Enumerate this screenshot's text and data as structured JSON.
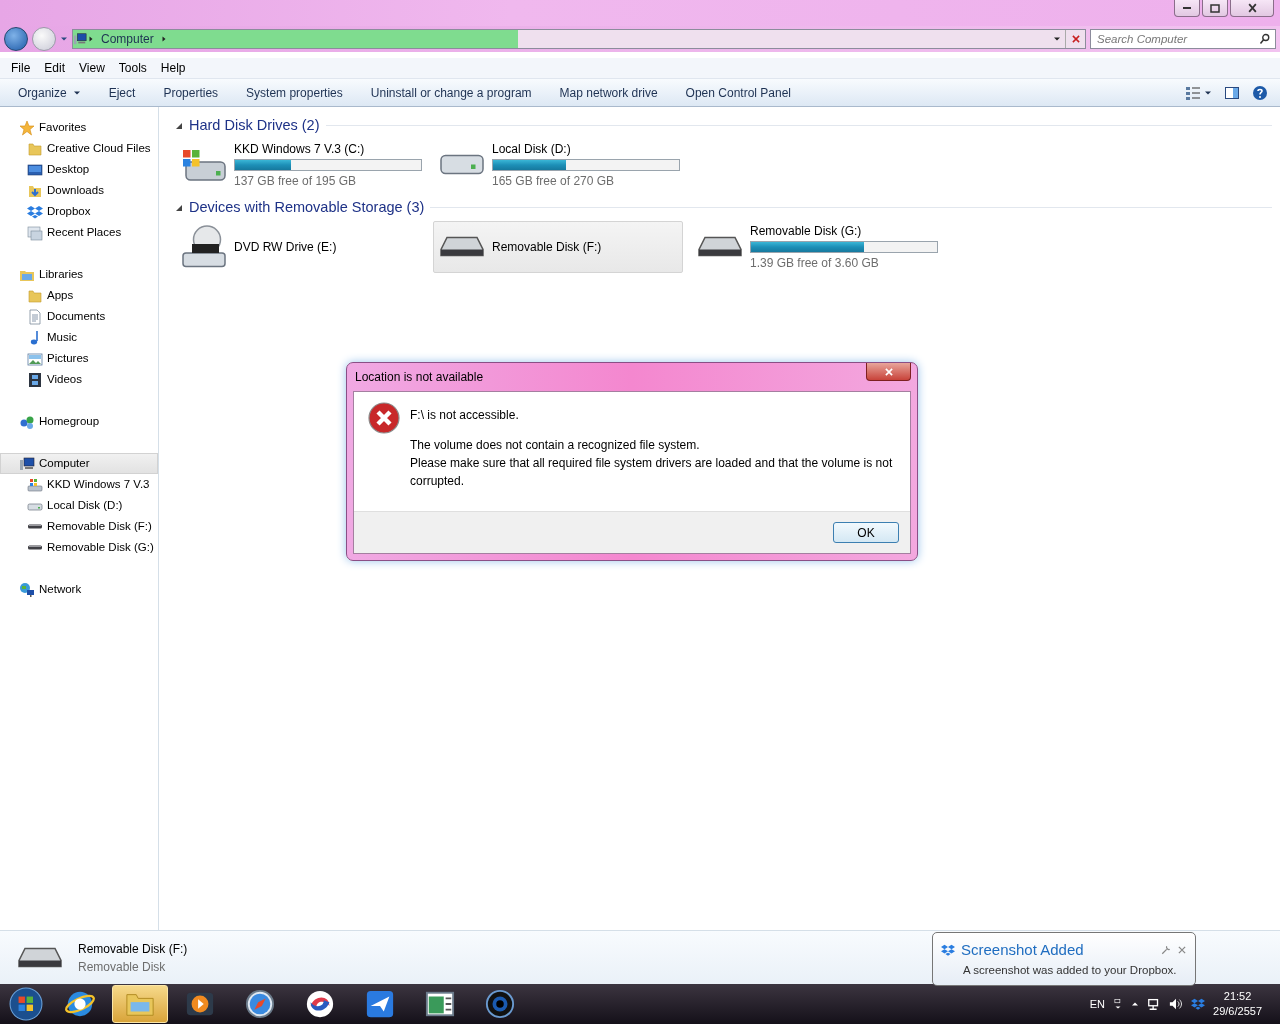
{
  "address": {
    "crumbs": [
      "Computer"
    ],
    "level": 0.44
  },
  "search": {
    "placeholder": "Search Computer"
  },
  "menu": [
    "File",
    "Edit",
    "View",
    "Tools",
    "Help"
  ],
  "toolbar": [
    {
      "label": "Organize",
      "dropdown": true
    },
    {
      "label": "Eject",
      "dropdown": false
    },
    {
      "label": "Properties",
      "dropdown": false
    },
    {
      "label": "System properties",
      "dropdown": false
    },
    {
      "label": "Uninstall or change a program",
      "dropdown": false
    },
    {
      "label": "Map network drive",
      "dropdown": false
    },
    {
      "label": "Open Control Panel",
      "dropdown": false
    }
  ],
  "sidebar": [
    {
      "label": "Favorites",
      "kind": "star",
      "selected": false,
      "children": [
        {
          "label": "Creative Cloud Files",
          "kind": "folder",
          "selected": false
        },
        {
          "label": "Desktop",
          "kind": "desktop",
          "selected": false
        },
        {
          "label": "Downloads",
          "kind": "download",
          "selected": false
        },
        {
          "label": "Dropbox",
          "kind": "dropbox",
          "selected": false
        },
        {
          "label": "Recent Places",
          "kind": "recent",
          "selected": false
        }
      ]
    },
    {
      "label": "Libraries",
      "kind": "library",
      "selected": false,
      "children": [
        {
          "label": "Apps",
          "kind": "folder",
          "selected": false
        },
        {
          "label": "Documents",
          "kind": "document",
          "selected": false
        },
        {
          "label": "Music",
          "kind": "music",
          "selected": false
        },
        {
          "label": "Pictures",
          "kind": "pictures",
          "selected": false
        },
        {
          "label": "Videos",
          "kind": "videos",
          "selected": false
        }
      ]
    },
    {
      "label": "Homegroup",
      "kind": "homegroup",
      "selected": false
    },
    {
      "label": "Computer",
      "kind": "computer",
      "selected": true,
      "children": [
        {
          "label": "KKD Windows 7 V.3",
          "kind": "windisk",
          "selected": false
        },
        {
          "label": "Local Disk (D:)",
          "kind": "disk",
          "selected": false
        },
        {
          "label": "Removable Disk (F:)",
          "kind": "usb",
          "selected": false
        },
        {
          "label": "Removable Disk (G:)",
          "kind": "usb",
          "selected": false
        }
      ]
    },
    {
      "label": "Network",
      "kind": "network",
      "selected": false
    }
  ],
  "groups": [
    {
      "title": "Hard Disk Drives (2)",
      "drives": [
        {
          "name": "KKD Windows 7 V.3 (C:)",
          "kind": "windows",
          "level": 0.3,
          "free": "137 GB free of 195 GB",
          "selected": false
        },
        {
          "name": "Local Disk (D:)",
          "kind": "hdd",
          "level": 0.39,
          "free": "165 GB free of 270 GB",
          "selected": false
        }
      ]
    },
    {
      "title": "Devices with Removable Storage (3)",
      "drives": [
        {
          "name": "DVD RW Drive (E:)",
          "kind": "dvd",
          "selected": false
        },
        {
          "name": "Removable Disk (F:)",
          "kind": "usb",
          "selected": true
        },
        {
          "name": "Removable Disk (G:)",
          "kind": "usb",
          "level": 0.61,
          "free": "1.39 GB free of 3.60 GB",
          "selected": false
        }
      ]
    }
  ],
  "dialog": {
    "title": "Location is not available",
    "heading": "F:\\ is not accessible.",
    "lines": [
      "The volume does not contain a recognized file system.",
      "Please make sure that all required file system drivers are loaded and that the volume is not corrupted."
    ],
    "button": "OK"
  },
  "details": {
    "name": "Removable Disk (F:)",
    "type": "Removable Disk"
  },
  "notification": {
    "title": "Screenshot Added",
    "text": "A screenshot was added to your Dropbox."
  },
  "taskbar": [
    {
      "kind": "browser",
      "selected": false
    },
    {
      "kind": "explorer",
      "selected": true
    },
    {
      "kind": "media",
      "selected": false
    },
    {
      "kind": "compass",
      "selected": false
    },
    {
      "kind": "swirl",
      "selected": false
    },
    {
      "kind": "plane",
      "selected": false
    },
    {
      "kind": "window",
      "selected": false
    },
    {
      "kind": "lens",
      "selected": false
    }
  ],
  "tray": {
    "language": "EN",
    "time": "21:52",
    "date": "29/6/2557"
  }
}
